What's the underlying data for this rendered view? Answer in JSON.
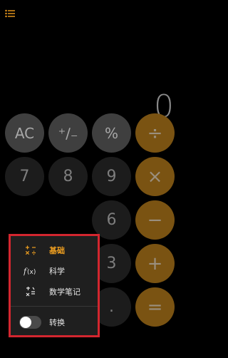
{
  "display": {
    "value": "0"
  },
  "keypad": {
    "row1": [
      "AC",
      "⁺∕₋",
      "%",
      "÷"
    ],
    "row2": [
      "7",
      "8",
      "9",
      "×"
    ],
    "row3": [
      "6",
      "−"
    ],
    "row4": [
      "3",
      "+"
    ],
    "row5": [
      ".",
      "="
    ]
  },
  "mode_menu": {
    "items": [
      {
        "icon": "basic-calc-icon",
        "label": "基础",
        "active": true
      },
      {
        "icon": "function-fx-icon",
        "label": "科学",
        "active": false
      },
      {
        "icon": "math-notes-icon",
        "label": "数学笔记",
        "active": false
      }
    ],
    "toggle": {
      "label": "转换",
      "on": false
    }
  },
  "colors": {
    "accent": "#f0a020",
    "operator_key": "#7a5312",
    "function_key": "#3f3f3f",
    "number_key": "#1c1c1c",
    "highlight_frame": "#d3262f"
  }
}
